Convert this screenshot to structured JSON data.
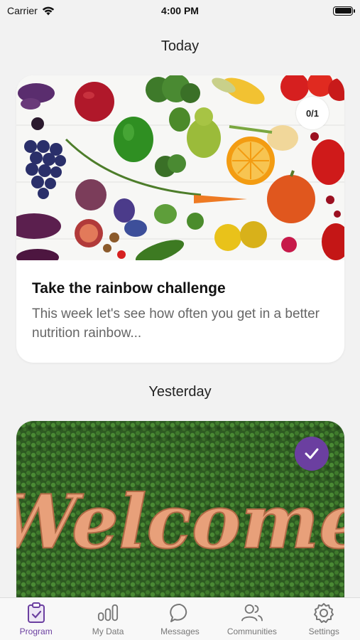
{
  "status_bar": {
    "carrier": "Carrier",
    "time": "4:00 PM",
    "battery_level": 1.0
  },
  "sections": {
    "today": "Today",
    "yesterday": "Yesterday"
  },
  "cards": [
    {
      "title": "Take the rainbow challenge",
      "body": "This week let's see how often you get in a better nutrition rainbow...",
      "progress": "0/1",
      "image_icon": "vegetables-image"
    },
    {
      "image_text": "Welcome",
      "completed": true,
      "image_icon": "welcome-sign-image"
    }
  ],
  "tabs": [
    {
      "label": "Program",
      "icon": "clipboard-check-icon",
      "active": true
    },
    {
      "label": "My Data",
      "icon": "bar-chart-icon",
      "active": false
    },
    {
      "label": "Messages",
      "icon": "chat-bubble-icon",
      "active": false
    },
    {
      "label": "Communities",
      "icon": "people-icon",
      "active": false
    },
    {
      "label": "Settings",
      "icon": "gear-icon",
      "active": false
    }
  ],
  "colors": {
    "accent": "#6b3fa0",
    "background": "#f2f2f2"
  }
}
